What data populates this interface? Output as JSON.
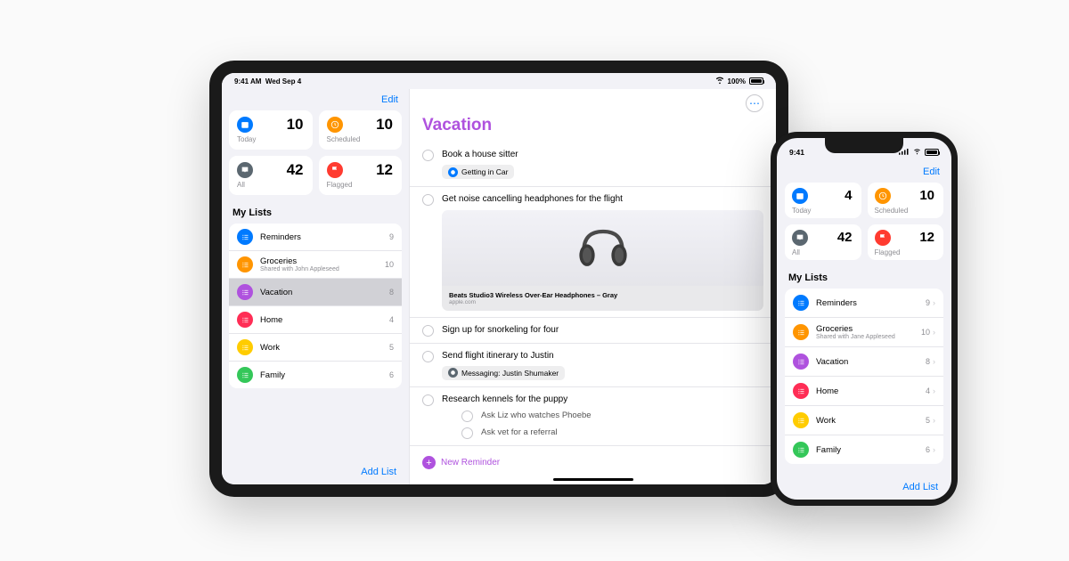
{
  "ipad": {
    "status": {
      "time": "9:41 AM",
      "date": "Wed Sep 4",
      "battery": "100%"
    },
    "edit": "Edit",
    "smartLists": [
      {
        "label": "Today",
        "count": "10",
        "color": "#007aff",
        "icon": "calendar"
      },
      {
        "label": "Scheduled",
        "count": "10",
        "color": "#ff9500",
        "icon": "clock"
      },
      {
        "label": "All",
        "count": "42",
        "color": "#5b6770",
        "icon": "inbox"
      },
      {
        "label": "Flagged",
        "count": "12",
        "color": "#ff3b30",
        "icon": "flag"
      }
    ],
    "myListsHeader": "My Lists",
    "lists": [
      {
        "label": "Reminders",
        "count": "9",
        "color": "#007aff",
        "icon": "list"
      },
      {
        "label": "Groceries",
        "sublabel": "Shared with John Appleseed",
        "count": "10",
        "color": "#ff9500",
        "icon": "list"
      },
      {
        "label": "Vacation",
        "count": "8",
        "color": "#af52de",
        "icon": "list",
        "selected": true
      },
      {
        "label": "Home",
        "count": "4",
        "color": "#ff2d55",
        "icon": "list"
      },
      {
        "label": "Work",
        "count": "5",
        "color": "#ffcc00",
        "icon": "list"
      },
      {
        "label": "Family",
        "count": "6",
        "color": "#34c759",
        "icon": "list"
      }
    ],
    "addList": "Add List",
    "detail": {
      "title": "Vacation",
      "reminders": [
        {
          "title": "Book a house sitter",
          "tag": {
            "icon": "car",
            "color": "#007aff",
            "label": "Getting in Car"
          }
        },
        {
          "title": "Get noise cancelling headphones for the flight",
          "link": {
            "title": "Beats Studio3 Wireless Over-Ear Headphones – Gray",
            "domain": "apple.com"
          }
        },
        {
          "title": "Sign up for snorkeling for four"
        },
        {
          "title": "Send flight itinerary to Justin",
          "tag": {
            "icon": "message",
            "color": "#5b6770",
            "label": "Messaging: Justin Shumaker"
          }
        },
        {
          "title": "Research kennels for the puppy",
          "subtasks": [
            "Ask Liz who watches Phoebe",
            "Ask vet for a referral"
          ]
        }
      ],
      "newReminder": "New Reminder"
    }
  },
  "iphone": {
    "status": {
      "time": "9:41"
    },
    "edit": "Edit",
    "smartLists": [
      {
        "label": "Today",
        "count": "4",
        "color": "#007aff"
      },
      {
        "label": "Scheduled",
        "count": "10",
        "color": "#ff9500"
      },
      {
        "label": "All",
        "count": "42",
        "color": "#5b6770"
      },
      {
        "label": "Flagged",
        "count": "12",
        "color": "#ff3b30"
      }
    ],
    "myListsHeader": "My Lists",
    "lists": [
      {
        "label": "Reminders",
        "count": "9",
        "color": "#007aff"
      },
      {
        "label": "Groceries",
        "sublabel": "Shared with Jane Appleseed",
        "count": "10",
        "color": "#ff9500"
      },
      {
        "label": "Vacation",
        "count": "8",
        "color": "#af52de"
      },
      {
        "label": "Home",
        "count": "4",
        "color": "#ff2d55"
      },
      {
        "label": "Work",
        "count": "5",
        "color": "#ffcc00"
      },
      {
        "label": "Family",
        "count": "6",
        "color": "#34c759"
      }
    ],
    "addList": "Add List"
  }
}
